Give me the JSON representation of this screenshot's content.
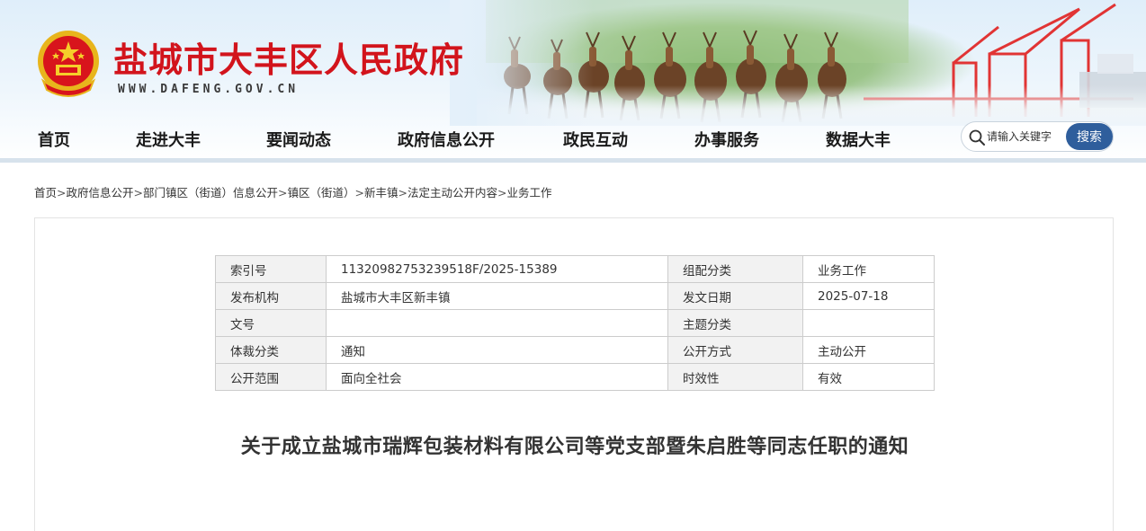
{
  "site": {
    "title": "盐城市大丰区人民政府",
    "url": "WWW.DAFENG.GOV.CN"
  },
  "nav": {
    "items": [
      {
        "label": "首页"
      },
      {
        "label": "走进大丰"
      },
      {
        "label": "要闻动态"
      },
      {
        "label": "政府信息公开"
      },
      {
        "label": "政民互动"
      },
      {
        "label": "办事服务"
      },
      {
        "label": "数据大丰"
      }
    ]
  },
  "search": {
    "placeholder": "请输入关键字",
    "button_label": "搜索"
  },
  "breadcrumb": {
    "items": [
      "首页",
      "政府信息公开",
      "部门镇区（街道）信息公开",
      "镇区（街道）",
      "新丰镇",
      "法定主动公开内容",
      "业务工作"
    ],
    "separator": ">"
  },
  "meta": {
    "rows": [
      {
        "label1": "索引号",
        "value1": "11320982753239518F/2025-15389",
        "label2": "组配分类",
        "value2": "业务工作"
      },
      {
        "label1": "发布机构",
        "value1": "盐城市大丰区新丰镇",
        "label2": "发文日期",
        "value2": "2025-07-18"
      },
      {
        "label1": "文号",
        "value1": "",
        "label2": "主题分类",
        "value2": ""
      },
      {
        "label1": "体裁分类",
        "value1": "通知",
        "label2": "公开方式",
        "value2": "主动公开"
      },
      {
        "label1": "公开范围",
        "value1": "面向全社会",
        "label2": "时效性",
        "value2": "有效"
      }
    ]
  },
  "document": {
    "title": "关于成立盐城市瑞辉包装材料有限公司等党支部暨朱启胜等同志任职的通知"
  },
  "colors": {
    "title_red": "#d2141c",
    "search_button": "#2f5e9c",
    "label_bg": "#f2f2f2"
  },
  "icons": {
    "search": "search-icon",
    "emblem": "national-emblem-icon"
  }
}
